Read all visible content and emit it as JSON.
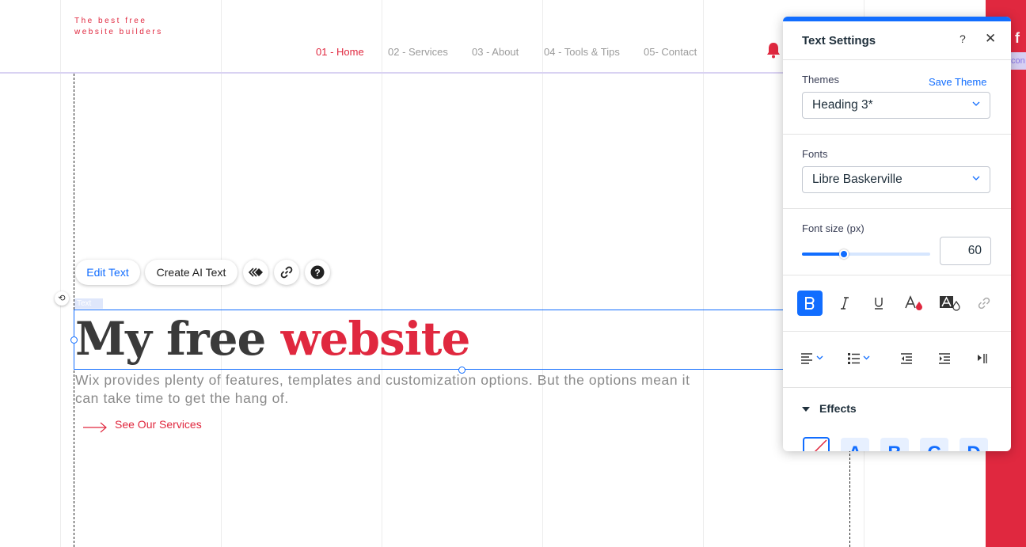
{
  "site": {
    "logo_line1": "The best free",
    "logo_line2": "website builders",
    "nav": [
      "01 - Home",
      "02 - Services",
      "03 - About",
      "04 - Tools & Tips",
      "05- Contact"
    ],
    "headline_dark": "My free ",
    "headline_red": "website",
    "description": "Wix provides plenty of features, templates and customization options. But the options mean it can take time to get the hang of.",
    "cta": "See Our Services",
    "strip_fb": "f",
    "strip_tab": "con"
  },
  "element_toolbar": {
    "edit_text": "Edit Text",
    "create_ai_text": "Create AI Text",
    "tag": "Text"
  },
  "panel": {
    "title": "Text Settings",
    "help": "?",
    "close": "✕",
    "themes_label": "Themes",
    "save_theme": "Save Theme",
    "theme_value": "Heading 3*",
    "fonts_label": "Fonts",
    "font_value": "Libre Baskerville",
    "font_size_label": "Font size (px)",
    "font_size_value": "60",
    "font_size_slider_fraction": 0.33,
    "effects_label": "Effects",
    "effect_tiles": [
      "A",
      "B",
      "C",
      "D"
    ]
  },
  "colors": {
    "accent": "#116dff",
    "brand_red": "#e0283f",
    "header_line": "#d9d2f2"
  }
}
